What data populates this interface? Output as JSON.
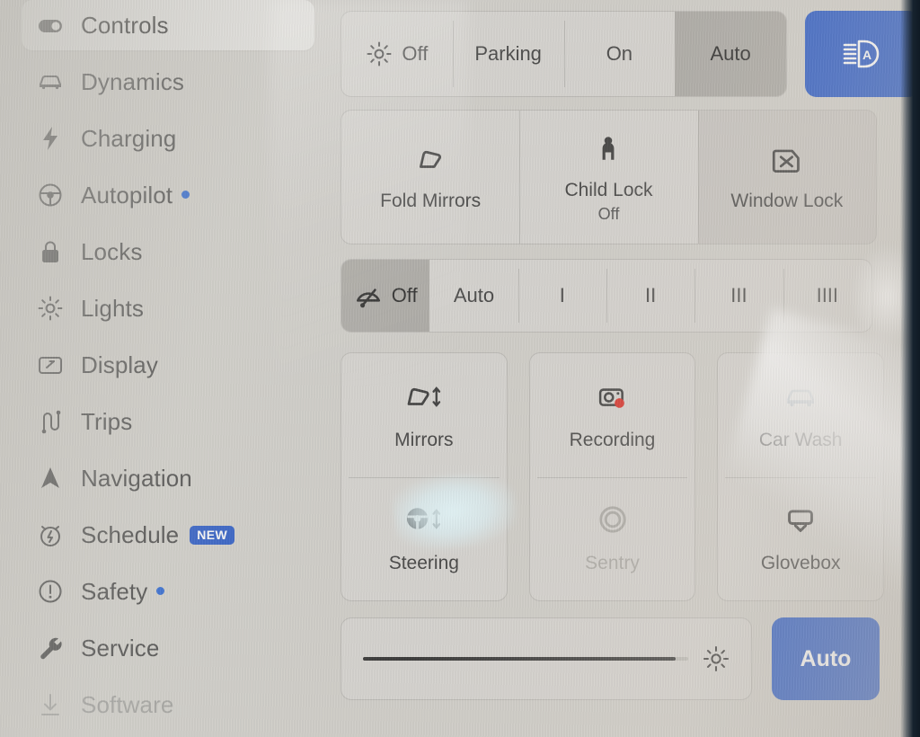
{
  "sidebar": {
    "items": [
      {
        "label": "Controls",
        "icon": "toggle-icon",
        "active": true,
        "badge": null
      },
      {
        "label": "Dynamics",
        "icon": "car-icon",
        "active": false,
        "badge": null
      },
      {
        "label": "Charging",
        "icon": "bolt-icon",
        "active": false,
        "badge": null
      },
      {
        "label": "Autopilot",
        "icon": "steering-icon",
        "active": false,
        "badge": "dot"
      },
      {
        "label": "Locks",
        "icon": "lock-icon",
        "active": false,
        "badge": null
      },
      {
        "label": "Lights",
        "icon": "sun-icon",
        "active": false,
        "badge": null
      },
      {
        "label": "Display",
        "icon": "display-icon",
        "active": false,
        "badge": null
      },
      {
        "label": "Trips",
        "icon": "route-icon",
        "active": false,
        "badge": null
      },
      {
        "label": "Navigation",
        "icon": "navigation-icon",
        "active": false,
        "badge": null
      },
      {
        "label": "Schedule",
        "icon": "alarm-clock-icon",
        "active": false,
        "badge": "NEW"
      },
      {
        "label": "Safety",
        "icon": "warning-icon",
        "active": false,
        "badge": "dot"
      },
      {
        "label": "Service",
        "icon": "wrench-icon",
        "active": false,
        "badge": null
      },
      {
        "label": "Software",
        "icon": "download-icon",
        "active": false,
        "badge": null
      }
    ]
  },
  "headlights": {
    "options": [
      {
        "label": "Off",
        "icon": "sun-icon",
        "selected": false
      },
      {
        "label": "Parking",
        "icon": null,
        "selected": false
      },
      {
        "label": "On",
        "icon": null,
        "selected": false
      },
      {
        "label": "Auto",
        "icon": null,
        "selected": true
      }
    ],
    "high_beam_button": {
      "icon": "auto-high-beam-icon",
      "active": true
    }
  },
  "mirror_row": {
    "tiles": [
      {
        "label": "Fold Mirrors",
        "sub": null,
        "icon": "mirror-icon",
        "shaded": false
      },
      {
        "label": "Child Lock",
        "sub": "Off",
        "icon": "child-lock-icon",
        "shaded": false
      },
      {
        "label": "Window Lock",
        "sub": null,
        "icon": "window-lock-icon",
        "shaded": true
      }
    ]
  },
  "wipers": {
    "options": [
      {
        "label": "Off",
        "icon": "wiper-icon",
        "selected": true
      },
      {
        "label": "Auto",
        "icon": null,
        "selected": false
      },
      {
        "label": "I",
        "icon": null,
        "selected": false
      },
      {
        "label": "II",
        "icon": null,
        "selected": false
      },
      {
        "label": "III",
        "icon": null,
        "selected": false
      },
      {
        "label": "IIII",
        "icon": null,
        "selected": false
      }
    ]
  },
  "quick_grid": {
    "columns": [
      {
        "cells": [
          {
            "label": "Mirrors",
            "icon": "mirror-adjust-icon",
            "disabled": false
          },
          {
            "label": "Steering",
            "icon": "steering-adjust-icon",
            "disabled": false
          }
        ]
      },
      {
        "cells": [
          {
            "label": "Recording",
            "icon": "dashcam-record-icon",
            "disabled": false
          },
          {
            "label": "Sentry",
            "icon": "sentry-icon",
            "disabled": true
          }
        ]
      },
      {
        "cells": [
          {
            "label": "Car Wash",
            "icon": "car-wash-icon",
            "disabled": false
          },
          {
            "label": "Glovebox",
            "icon": "glovebox-icon",
            "disabled": false
          }
        ]
      }
    ]
  },
  "brightness": {
    "value_percent": 96,
    "icon": "brightness-sun-icon",
    "auto_label": "Auto",
    "auto_active": true
  },
  "colors": {
    "accent_blue": "#1b4fc4",
    "badge_blue": "#1b5bd0",
    "record_red": "#d8271f",
    "selected_gray": "#8c8a84",
    "screen_bg": "#cfcdc8",
    "text_primary": "#3a3a3a",
    "text_dim": "#a8a6a2"
  }
}
